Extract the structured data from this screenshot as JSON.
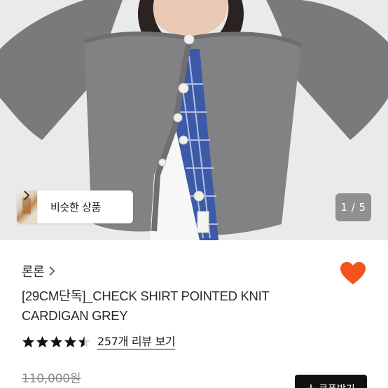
{
  "gallery": {
    "similar_label": "비슷한 상품",
    "page_indicator": "1 / 5",
    "image_description_icon": "product-photo"
  },
  "product": {
    "brand": "론론",
    "title": "[29CM단독]_CHECK SHIRT POINTED KNIT CARDIGAN GREY",
    "rating": 4.5,
    "review_link": "257개 리뷰 보기",
    "original_price": "110,000원",
    "liked": true
  },
  "actions": {
    "coupon_label": "쿠폰받기"
  },
  "colors": {
    "heart": "#f2541c",
    "star": "#111111",
    "coupon_bg": "#111111"
  }
}
